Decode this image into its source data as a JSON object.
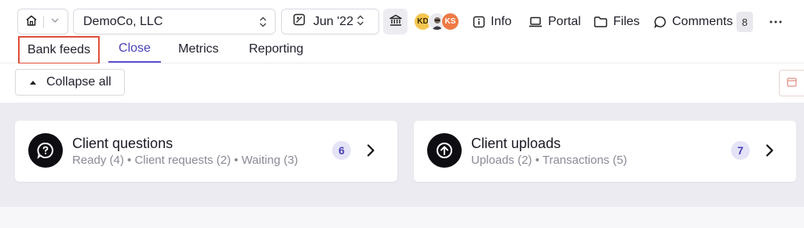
{
  "header": {
    "company": "DemoCo, LLC",
    "period": "Jun '22",
    "avatars": [
      "KD",
      "KS"
    ],
    "links": {
      "info": "Info",
      "portal": "Portal",
      "files": "Files",
      "comments": "Comments"
    },
    "comments_count": "8"
  },
  "tabs": [
    {
      "label": "Bank feeds",
      "highlighted": true
    },
    {
      "label": "Close",
      "active": true
    },
    {
      "label": "Metrics"
    },
    {
      "label": "Reporting"
    }
  ],
  "toolbar": {
    "collapse_label": "Collapse all"
  },
  "cards": [
    {
      "title": "Client questions",
      "subtitle": "Ready (4) • Client requests (2) • Waiting (3)",
      "badge": "6",
      "icon": "question-bubble-icon"
    },
    {
      "title": "Client uploads",
      "subtitle": "Uploads (2) • Transactions (5)",
      "badge": "7",
      "icon": "upload-arrow-icon"
    }
  ],
  "colors": {
    "accent": "#5b4fd0",
    "highlight_border": "#e04e3c",
    "badge_bg": "#e5e4f7",
    "background": "#ebebf1"
  }
}
